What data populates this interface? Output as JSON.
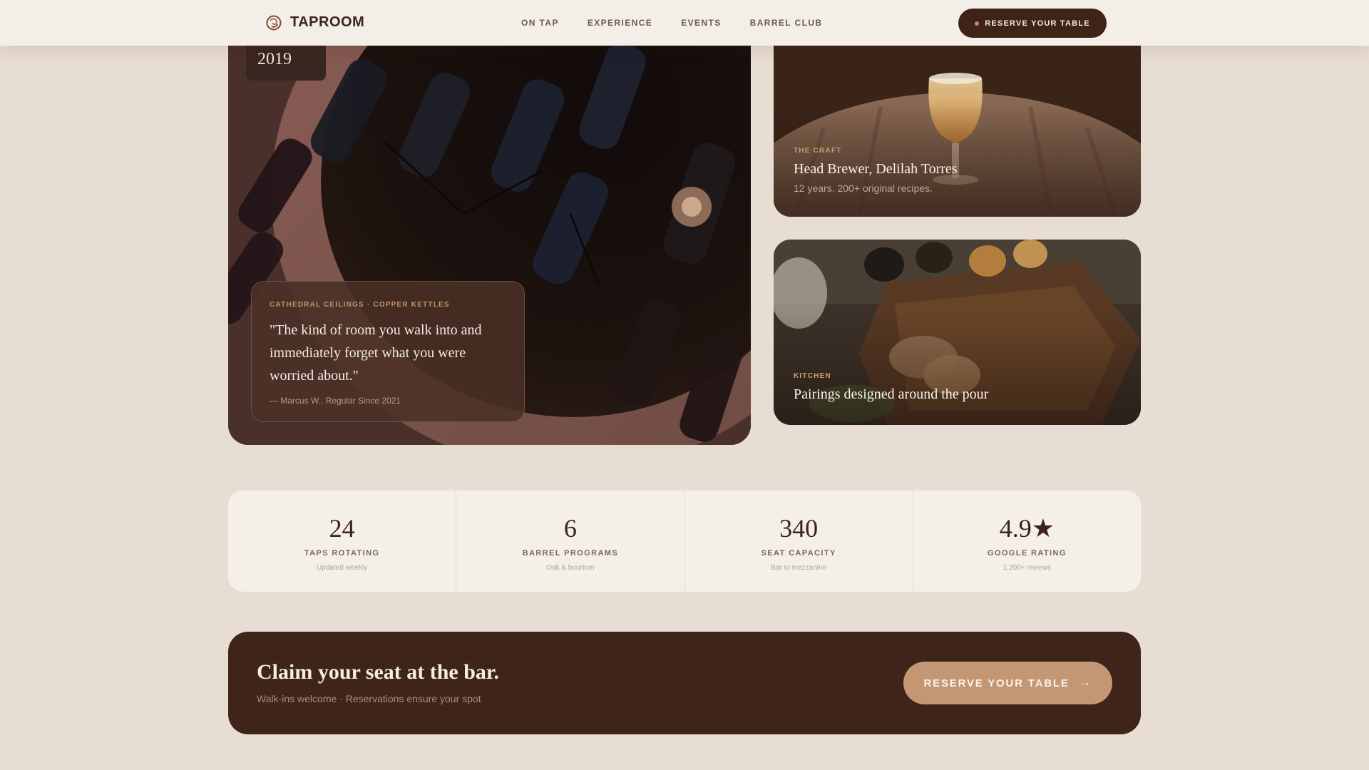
{
  "nav": {
    "brand": "TAPROOM",
    "links": [
      "ON TAP",
      "EXPERIENCE",
      "EVENTS",
      "BARREL CLUB"
    ],
    "cta_label": "RESERVE YOUR TABLE"
  },
  "hero": {
    "year": "2019",
    "eyebrow": "CATHEDRAL CEILINGS · COPPER KETTLES",
    "quote": "\"The kind of room you walk into and immediately forget what you were worried about.\"",
    "author": "— Marcus W., Regular Since 2021"
  },
  "craft": {
    "eyebrow": "THE CRAFT",
    "title": "Head Brewer, Delilah Torres",
    "subtitle": "12 years. 200+ original recipes."
  },
  "kitchen": {
    "eyebrow": "KITCHEN",
    "title": "Pairings designed around the pour"
  },
  "stats": [
    {
      "value": "24",
      "label": "TAPS ROTATING",
      "sub": "Updated weekly"
    },
    {
      "value": "6",
      "label": "BARREL PROGRAMS",
      "sub": "Oak & bourbon"
    },
    {
      "value": "340",
      "label": "SEAT CAPACITY",
      "sub": "Bar to mezzanine"
    },
    {
      "value": "4.9★",
      "label": "GOOGLE RATING",
      "sub": "1,200+ reviews"
    }
  ],
  "cta": {
    "title": "Claim your seat at the bar.",
    "subtitle": "Walk-ins welcome · Reservations ensure your spot",
    "button": "RESERVE YOUR TABLE"
  },
  "colors": {
    "background": "#e8ddd2",
    "dark_brown": "#3e2419",
    "copper": "#c39674",
    "accent_label": "#cf9c70"
  }
}
